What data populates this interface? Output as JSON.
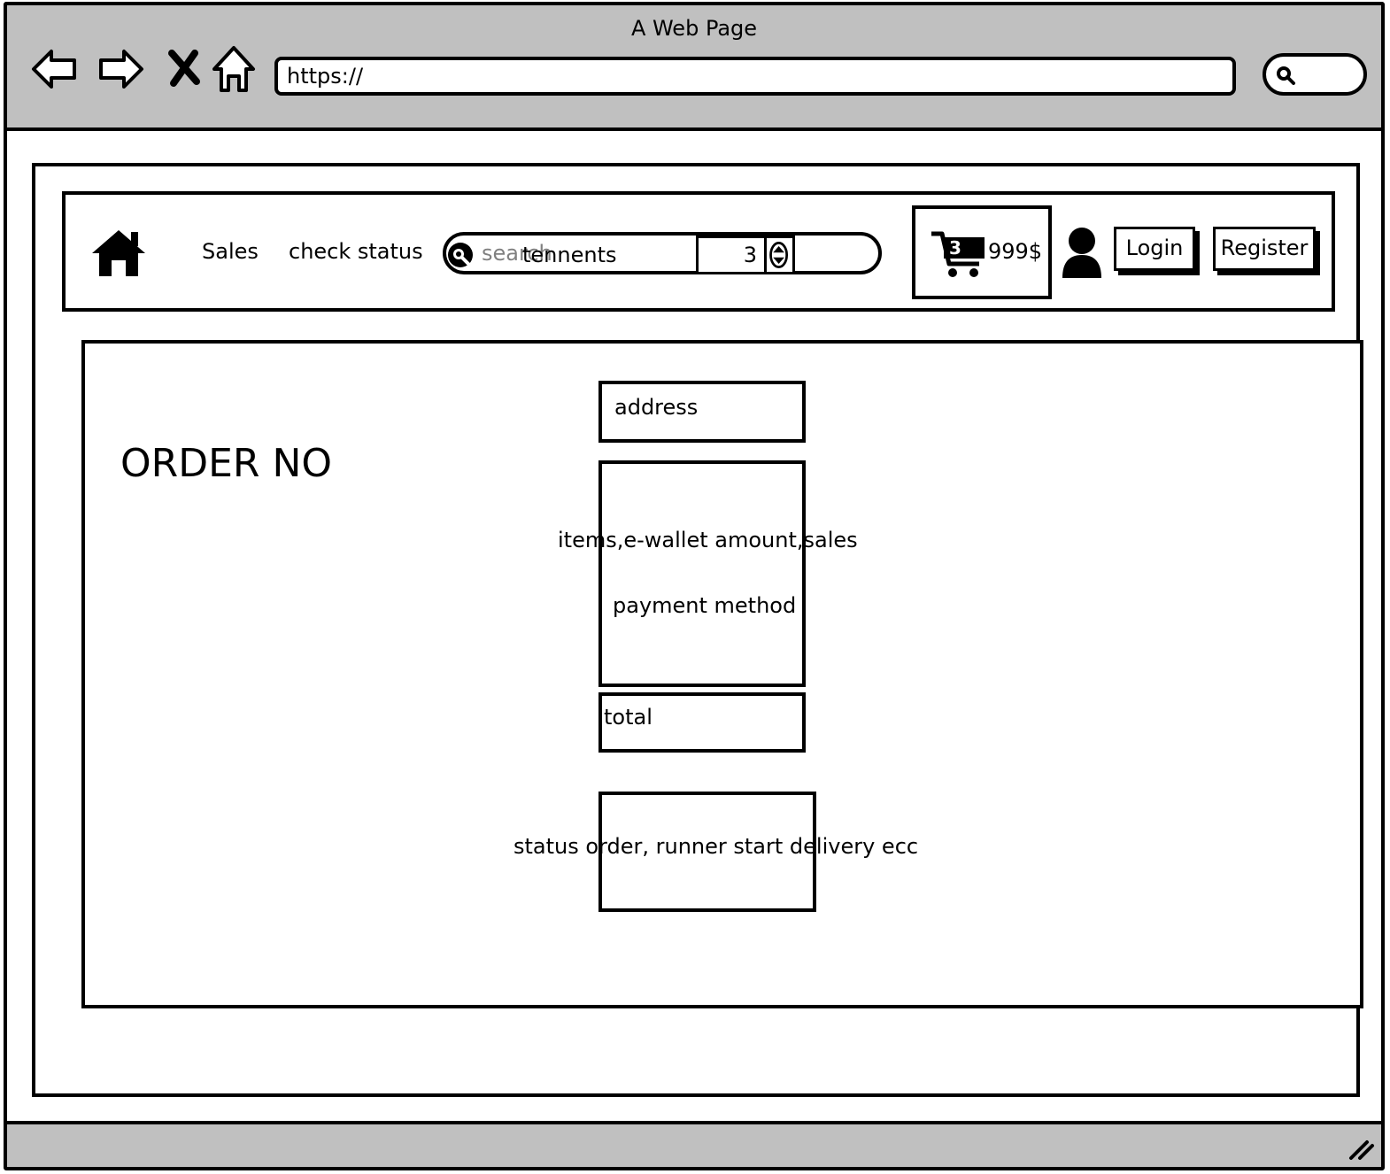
{
  "window": {
    "title": "A Web Page",
    "url": "https://"
  },
  "navbar": {
    "links": [
      "Sales",
      "check status"
    ],
    "search": {
      "placeholder": "search",
      "value": "tennents"
    },
    "quantity": "3",
    "cart": {
      "count": "3",
      "amount": "999$"
    },
    "login_label": "Login",
    "register_label": "Register"
  },
  "main": {
    "order_title": "ORDER NO",
    "address_label": "address",
    "items_label": "items,e-wallet amount,sales",
    "payment_label": "payment method",
    "total_label": "total",
    "status_label": "status order, runner start delivery ecc"
  }
}
